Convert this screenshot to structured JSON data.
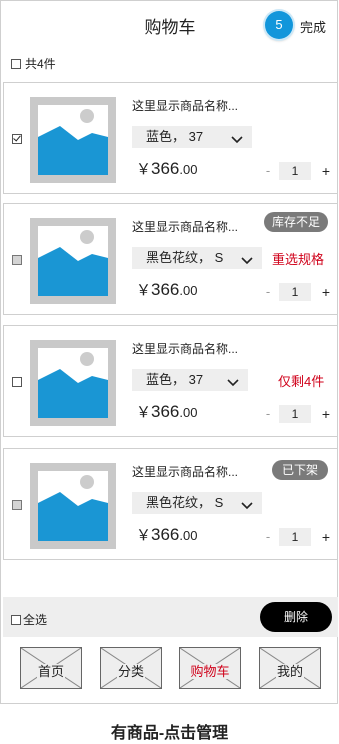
{
  "header": {
    "title": "购物车",
    "badge": "5",
    "done": "完成"
  },
  "summary": {
    "count_label": "共4件"
  },
  "items": [
    {
      "name": "这里显示商品名称...",
      "spec": "蓝色， 37",
      "price_currency": "￥",
      "price_int": "366",
      "price_dec": ".00",
      "qty": "1",
      "checked": true,
      "tag": "",
      "note": ""
    },
    {
      "name": "这里显示商品名称...",
      "spec": "黑色花纹， S",
      "price_currency": "￥",
      "price_int": "366",
      "price_dec": ".00",
      "qty": "1",
      "checked": false,
      "tag": "库存不足",
      "note": "重选规格"
    },
    {
      "name": "这里显示商品名称...",
      "spec": "蓝色， 37",
      "price_currency": "￥",
      "price_int": "366",
      "price_dec": ".00",
      "qty": "1",
      "checked": false,
      "tag": "",
      "note": "仅剩4件"
    },
    {
      "name": "这里显示商品名称...",
      "spec": "黑色花纹， S",
      "price_currency": "￥",
      "price_int": "366",
      "price_dec": ".00",
      "qty": "1",
      "checked": false,
      "tag": "已下架",
      "note": ""
    }
  ],
  "bottom": {
    "select_all": "全选",
    "delete": "删除"
  },
  "tabs": [
    {
      "label": "首页",
      "active": false
    },
    {
      "label": "分类",
      "active": false
    },
    {
      "label": "购物车",
      "active": true
    },
    {
      "label": "我的",
      "active": false
    }
  ],
  "caption": "有商品-点击管理",
  "colors": {
    "accent_blue": "#1296db",
    "alert_red": "#d0021b",
    "tag_gray": "#7a7a7a",
    "delete_black": "#000000"
  },
  "icons": {
    "thumbnail": "image-placeholder-icon",
    "spec_arrow": "chevron-down-icon"
  }
}
